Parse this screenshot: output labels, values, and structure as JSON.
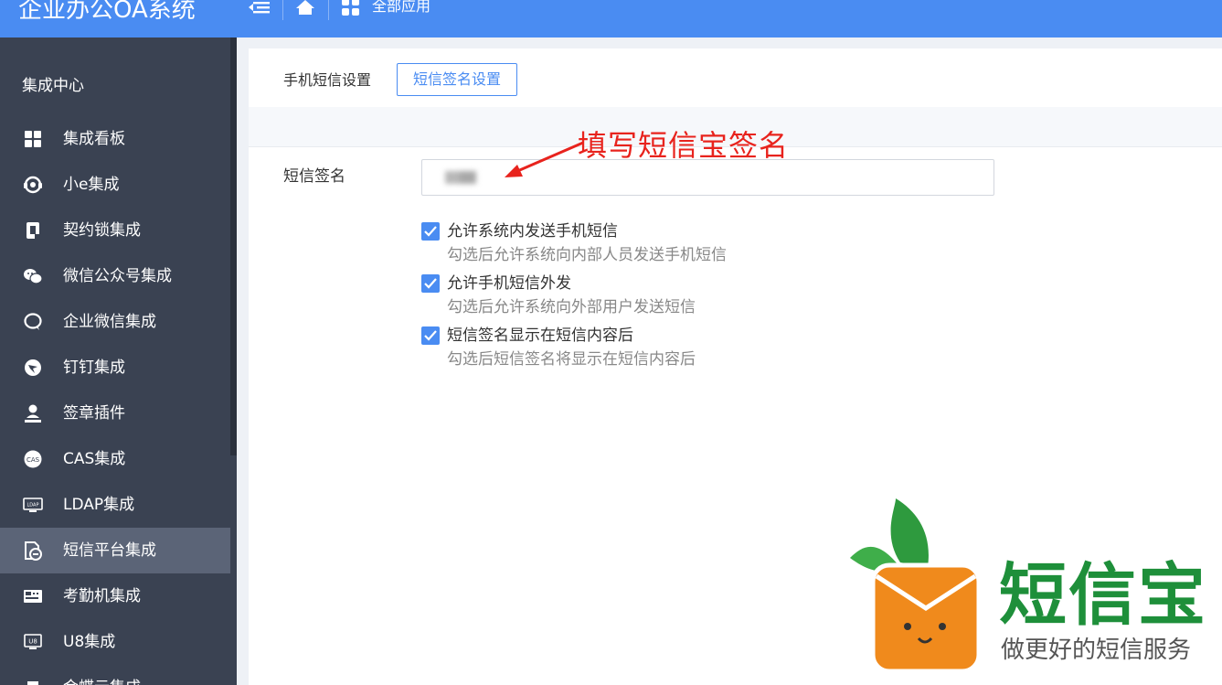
{
  "header": {
    "app_title": "企业办公OA系统",
    "apps_label": "全部应用"
  },
  "sidebar": {
    "section_title": "集成中心",
    "items": [
      {
        "label": "集成看板",
        "icon": "grid-icon"
      },
      {
        "label": "小e集成",
        "icon": "headset-icon"
      },
      {
        "label": "契约锁集成",
        "icon": "lock-icon"
      },
      {
        "label": "微信公众号集成",
        "icon": "wechat-icon"
      },
      {
        "label": "企业微信集成",
        "icon": "wecom-icon"
      },
      {
        "label": "钉钉集成",
        "icon": "dingtalk-icon"
      },
      {
        "label": "签章插件",
        "icon": "stamp-icon"
      },
      {
        "label": "CAS集成",
        "icon": "cas-icon"
      },
      {
        "label": "LDAP集成",
        "icon": "ldap-icon"
      },
      {
        "label": "短信平台集成",
        "icon": "sms-icon",
        "active": true
      },
      {
        "label": "考勤机集成",
        "icon": "attendance-icon"
      },
      {
        "label": "U8集成",
        "icon": "u8-icon"
      },
      {
        "label": "金蝶云集成",
        "icon": "cloud-icon"
      }
    ]
  },
  "tabs": {
    "sms_settings": "手机短信设置",
    "signature_settings": "短信签名设置"
  },
  "form": {
    "signature_label": "短信签名",
    "signature_value": "",
    "annotation": "填写短信宝签名",
    "options": [
      {
        "title": "允许系统内发送手机短信",
        "desc": "勾选后允许系统向内部人员发送手机短信",
        "checked": true
      },
      {
        "title": "允许手机短信外发",
        "desc": "勾选后允许系统向外部用户发送短信",
        "checked": true
      },
      {
        "title": "短信签名显示在短信内容后",
        "desc": "勾选后短信签名将显示在短信内容后",
        "checked": true
      }
    ]
  },
  "watermark": {
    "brand": "短信宝",
    "slogan": "做更好的短信服务"
  },
  "colors": {
    "accent": "#4a8cf2",
    "sidebar_bg": "#3a4252",
    "annotation": "#e8231d",
    "brand_green": "#1e8f3a",
    "brand_orange": "#f08a1c"
  }
}
